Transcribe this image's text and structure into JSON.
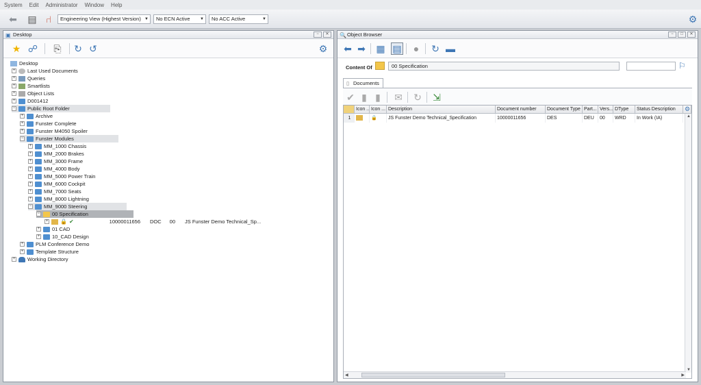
{
  "menu": [
    "System",
    "Edit",
    "Administrator",
    "Window",
    "Help"
  ],
  "toolbar": {
    "view_combo": "Engineering View (Highest Version)",
    "ecn_combo": "No ECN Active",
    "acc_combo": "No ACC Active"
  },
  "desktop": {
    "title": "Desktop",
    "tree": [
      {
        "label": "Desktop"
      },
      {
        "label": "Last Used Documents"
      },
      {
        "label": "Queries"
      },
      {
        "label": "Smartlists"
      },
      {
        "label": "Object Lists"
      },
      {
        "label": "D001412"
      },
      {
        "label": "Public Root Folder"
      },
      {
        "label": "Archive"
      },
      {
        "label": "Funster Complete"
      },
      {
        "label": "Funster M4050 Spoiler"
      },
      {
        "label": "Funster Modules"
      },
      {
        "label": "MM_1000 Chassis"
      },
      {
        "label": "MM_2000 Brakes"
      },
      {
        "label": "MM_3000 Frame"
      },
      {
        "label": "MM_4000 Body"
      },
      {
        "label": "MM_5000 Power Train"
      },
      {
        "label": "MM_6000 Cockpit"
      },
      {
        "label": "MM_7000 Seats"
      },
      {
        "label": "MM_8000 Lightning"
      },
      {
        "label": "MM_9000 Steering"
      },
      {
        "label": "00 Specification"
      },
      {
        "label": "01 CAD"
      },
      {
        "label": "10_CAD Design"
      },
      {
        "label": "PLM Conference Demo"
      },
      {
        "label": "Template Structure"
      },
      {
        "label": "Working Directory"
      }
    ],
    "doc_row": {
      "number": "10000011656",
      "type": "DOC",
      "version": "00",
      "description": "JS Funster Demo Technical_Sp..."
    }
  },
  "object_browser": {
    "title": "Object Browser",
    "content_of_label": "Content Of",
    "content_of_value": "00 Specification",
    "tab_label": "Documents",
    "columns": [
      "Icon ...",
      "Icon ...",
      "Description",
      "Document number",
      "Document Type",
      "Part...",
      "Vers...",
      "DType",
      "Status Description"
    ],
    "rows": [
      {
        "index": "1",
        "description": "JS Funster Demo Technical_Specification",
        "number": "10000011656",
        "doc_type": "DES",
        "part": "DEU",
        "version": "00",
        "dtype": "WRD",
        "status": "In Work (IA)"
      }
    ]
  },
  "colors": {
    "accent": "#3f77b5",
    "folder": "#4f8fd0",
    "folder_open": "#f3c64a"
  }
}
